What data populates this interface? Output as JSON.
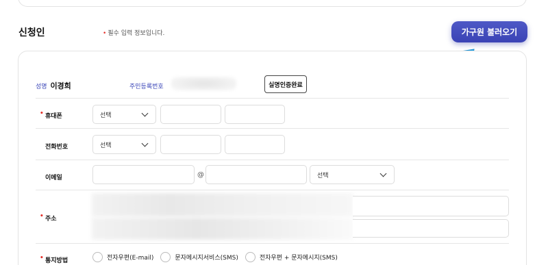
{
  "section": {
    "title": "신청인",
    "required_note": "필수 입력 정보입니다."
  },
  "load_family_button": "가구원 불러오기",
  "applicant": {
    "name_label": "성명",
    "name_value": "이경희",
    "rrn_label": "주민등록번호",
    "verify_button": "실명인증완료"
  },
  "phone": {
    "label": "휴대폰",
    "select_value": "선택"
  },
  "tel": {
    "label": "전화번호",
    "select_value": "선택"
  },
  "email": {
    "label": "이메일",
    "at": "@",
    "domain_select_value": "선택"
  },
  "address": {
    "label": "주소"
  },
  "notify": {
    "label": "통지방법",
    "options": [
      "전자우편(E-mail)",
      "문자메시지서비스(SMS)",
      "전자우편 + 문자메시지(SMS)"
    ]
  },
  "colors": {
    "accent": "#3d46b6",
    "required_dot": "#e4312b",
    "arrow": "#2aa7e8"
  }
}
